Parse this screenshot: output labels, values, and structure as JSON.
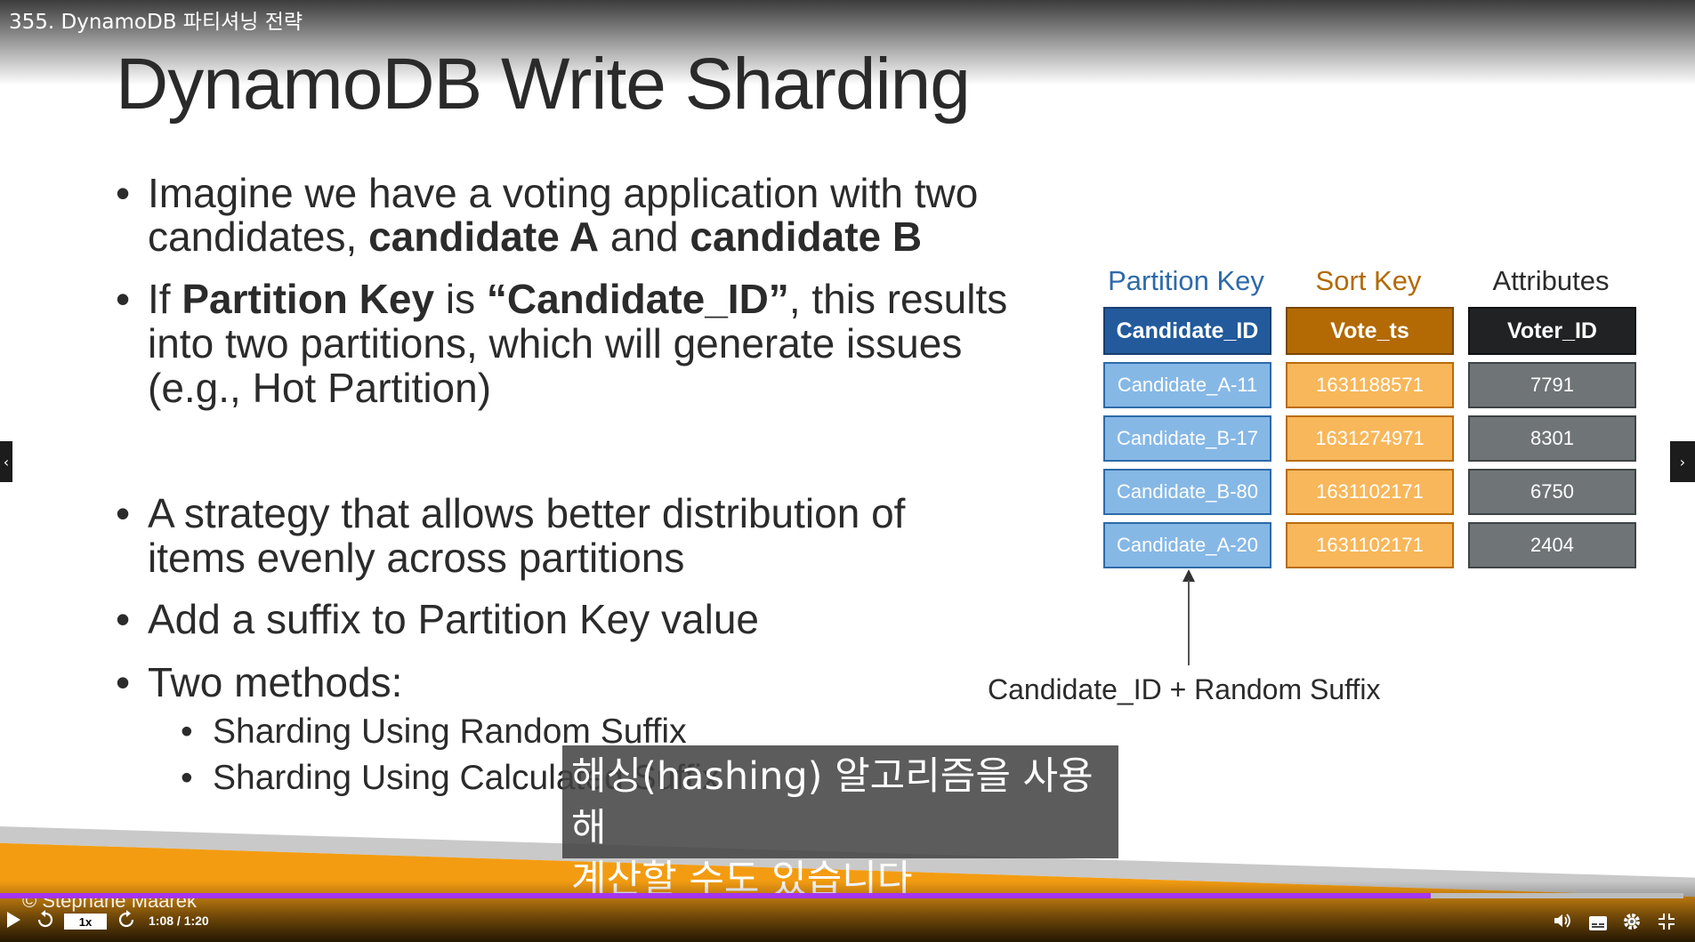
{
  "video": {
    "title": "355. DynamoDB 파티셔닝 전략",
    "copyright": "© Stephane Maarek",
    "speed": "1x",
    "time": "1:08 / 1:20",
    "progress": 0.85,
    "accent_color": "#a435f0"
  },
  "slide": {
    "title": "DynamoDB Write Sharding",
    "bullet1": {
      "line1": "Imagine we have a voting application with two",
      "line2_pre": "candidates, ",
      "b1": "candidate A",
      "mid": " and ",
      "b2": "candidate B"
    },
    "bullet2": {
      "pre": "If ",
      "b1": "Partition Key",
      "mid": " is ",
      "b2": "“Candidate_ID”",
      "post": ", this results",
      "line2": "into two partitions, which will generate issues",
      "line3": "(e.g., Hot Partition)"
    },
    "bullet3": {
      "line1": "A strategy that allows better distribution of",
      "line2": "items evenly across partitions"
    },
    "bullet4": "Add a suffix to Partition Key value",
    "bullet5": "Two methods:",
    "sub1": "Sharding Using Random Suffix",
    "sub2": "Sharding Using Calculated Suffix"
  },
  "table": {
    "group_headers": {
      "partition": "Partition Key",
      "sort": "Sort Key",
      "attributes": "Attributes"
    },
    "columns": [
      "Candidate_ID",
      "Vote_ts",
      "Voter_ID"
    ],
    "rows": [
      [
        "Candidate_A-11",
        "1631188571",
        "7791"
      ],
      [
        "Candidate_B-17",
        "1631274971",
        "8301"
      ],
      [
        "Candidate_B-80",
        "1631102171",
        "6750"
      ],
      [
        "Candidate_A-20",
        "1631102171",
        "2404"
      ]
    ],
    "colors": {
      "partition": "#225a9c",
      "sort": "#b36a05",
      "attributes": "#202223"
    }
  },
  "annotation": "Candidate_ID + Random Suffix",
  "caption": {
    "line1": "해싱(hashing) 알고리즘을 사용해",
    "line2": "계산할 수도 있습니다"
  },
  "controls": {
    "play": "play-icon",
    "rewind": "rewind-icon",
    "forward": "forward-icon",
    "volume": "volume-icon",
    "captions": "captions-icon",
    "settings": "gear-icon",
    "fullscreen": "fullscreen-exit-icon"
  }
}
